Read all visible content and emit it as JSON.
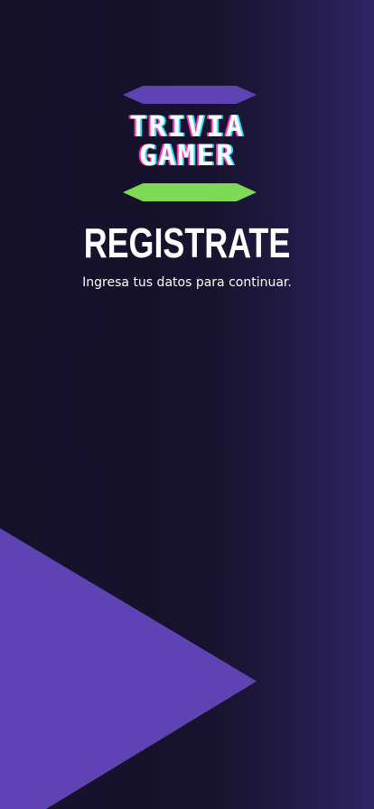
{
  "logo": {
    "line1": "TRIVIA",
    "line2": "GAMER"
  },
  "screen": {
    "title": "REGISTRATE",
    "subtitle": "Ingresa tus datos para continuar."
  },
  "colors": {
    "background_dark": "#16112b",
    "background_right": "#2f2466",
    "accent_purple": "#5f43b5",
    "accent_green": "#7ed957",
    "text_primary": "#ffffff",
    "logo_glitch_pink": "#ff2ea6",
    "logo_glitch_cyan": "#24e0ff"
  }
}
